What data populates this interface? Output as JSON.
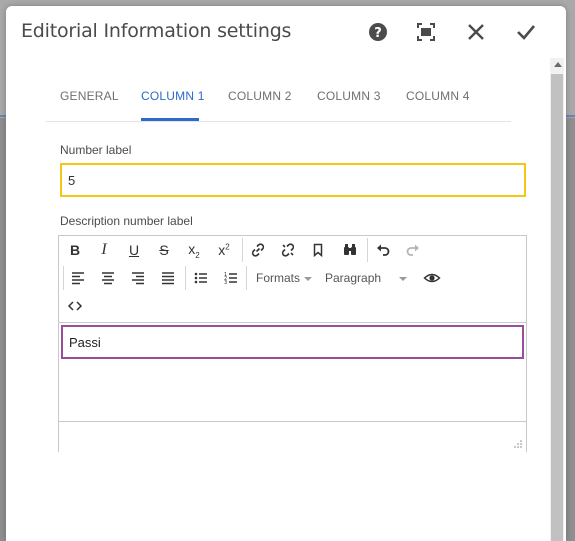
{
  "dialog": {
    "title": "Editorial Information settings"
  },
  "header_buttons": [
    {
      "name": "help-button",
      "icon": "help-icon"
    },
    {
      "name": "fullscreen-button",
      "icon": "fullscreen-icon"
    },
    {
      "name": "close-button",
      "icon": "close-icon"
    },
    {
      "name": "confirm-button",
      "icon": "checkmark-icon"
    }
  ],
  "tabs": [
    {
      "label": "GENERAL",
      "active": false
    },
    {
      "label": "COLUMN 1",
      "active": true
    },
    {
      "label": "COLUMN 2",
      "active": false
    },
    {
      "label": "COLUMN 3",
      "active": false
    },
    {
      "label": "COLUMN 4",
      "active": false
    }
  ],
  "number_label": {
    "label": "Number label",
    "value": "5"
  },
  "description": {
    "label": "Description number label",
    "content": "Passi"
  },
  "toolbar": {
    "row1": [
      "bold-icon",
      "italic-icon",
      "underline-icon",
      "strikethrough-icon",
      "subscript-icon",
      "superscript-icon",
      "link-icon",
      "unlink-icon",
      "anchor-icon",
      "find-replace-icon",
      "undo-icon",
      "redo-icon"
    ],
    "row2": [
      "align-left-icon",
      "align-center-icon",
      "align-right-icon",
      "align-justify-icon",
      "bullet-list-icon",
      "numbered-list-icon",
      "preview-icon"
    ],
    "row3": [
      "source-code-icon"
    ],
    "formats_label": "Formats",
    "paragraph_label": "Paragraph"
  },
  "colors": {
    "accent": "#2d6ac9",
    "input_focus": "#f5c518",
    "editor_focus": "#9b4c9d"
  }
}
